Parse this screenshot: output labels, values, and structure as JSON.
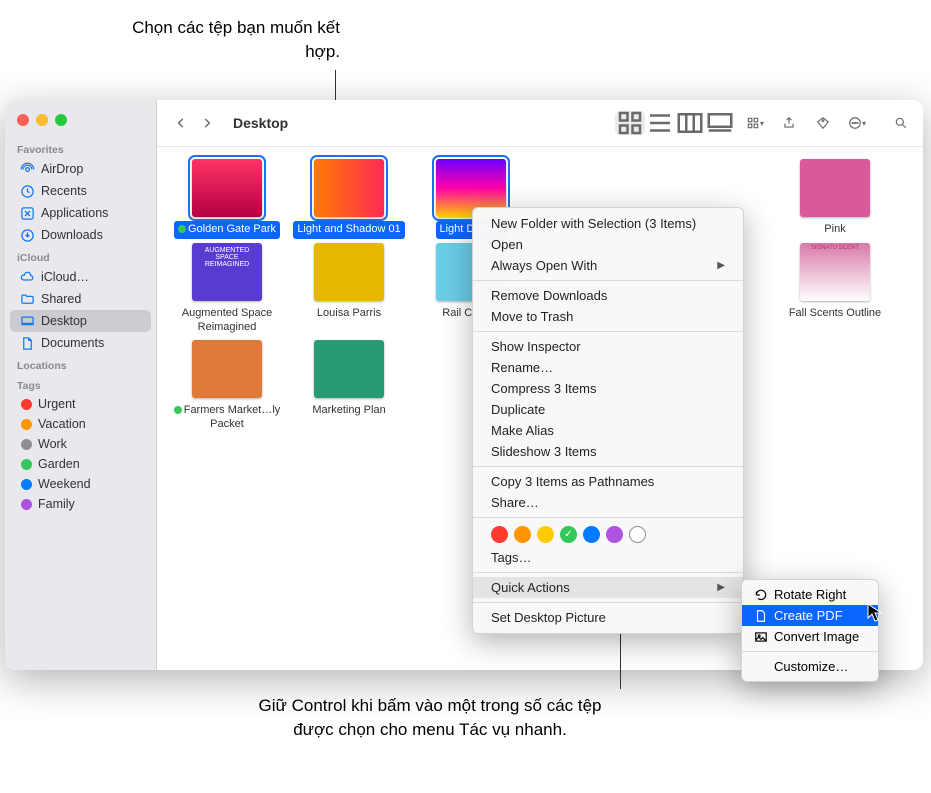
{
  "callouts": {
    "top": "Chọn các tệp bạn muốn kết hợp.",
    "bottom": "Giữ Control khi bấm vào một trong số các tệp được chọn cho menu Tác vụ nhanh."
  },
  "toolbar": {
    "location": "Desktop"
  },
  "sidebar": {
    "favorites_label": "Favorites",
    "icloud_label": "iCloud",
    "locations_label": "Locations",
    "tags_label": "Tags",
    "favorites": [
      {
        "label": "AirDrop"
      },
      {
        "label": "Recents"
      },
      {
        "label": "Applications"
      },
      {
        "label": "Downloads"
      }
    ],
    "icloud": [
      {
        "label": "iCloud…"
      },
      {
        "label": "Shared"
      },
      {
        "label": "Desktop"
      },
      {
        "label": "Documents"
      }
    ],
    "tags": [
      {
        "label": "Urgent",
        "color": "#ff3b30"
      },
      {
        "label": "Vacation",
        "color": "#ff9500"
      },
      {
        "label": "Work",
        "color": "#8e8e93"
      },
      {
        "label": "Garden",
        "color": "#34c759"
      },
      {
        "label": "Weekend",
        "color": "#007aff"
      },
      {
        "label": "Family",
        "color": "#af52de"
      }
    ]
  },
  "files": {
    "row1": [
      {
        "name": "Golden Gate Park",
        "dot": "#34c759"
      },
      {
        "name": "Light and Shadow 01"
      },
      {
        "name": "Light Display"
      },
      {
        "name": "Pink"
      }
    ],
    "row2": [
      {
        "name": "Augmented Space Reimagined",
        "thumbtext": "AUGMENTED SPACE REIMAGINED"
      },
      {
        "name": "Louisa Parris"
      },
      {
        "name": "Rail Chaser"
      },
      {
        "name": "Fall Scents Outline"
      }
    ],
    "row3": [
      {
        "name": "Farmers Market…ly Packet",
        "dot": "#34c759"
      },
      {
        "name": "Marketing Plan"
      }
    ]
  },
  "context_menu": {
    "items1": [
      "New Folder with Selection (3 Items)",
      "Open",
      "Always Open With"
    ],
    "items2": [
      "Remove Downloads",
      "Move to Trash"
    ],
    "items3": [
      "Show Inspector",
      "Rename…",
      "Compress 3 Items",
      "Duplicate",
      "Make Alias",
      "Slideshow 3 Items"
    ],
    "items4": [
      "Copy 3 Items as Pathnames",
      "Share…"
    ],
    "tags_label": "Tags…",
    "quick_actions": "Quick Actions",
    "set_desktop": "Set Desktop Picture",
    "tag_colors": [
      "#ff3b30",
      "#ff9500",
      "#ffcc00",
      "#34c759",
      "#007aff",
      "#af52de",
      "#8e8e93"
    ]
  },
  "submenu": {
    "rotate": "Rotate Right",
    "create_pdf": "Create PDF",
    "convert": "Convert Image",
    "customize": "Customize…"
  }
}
